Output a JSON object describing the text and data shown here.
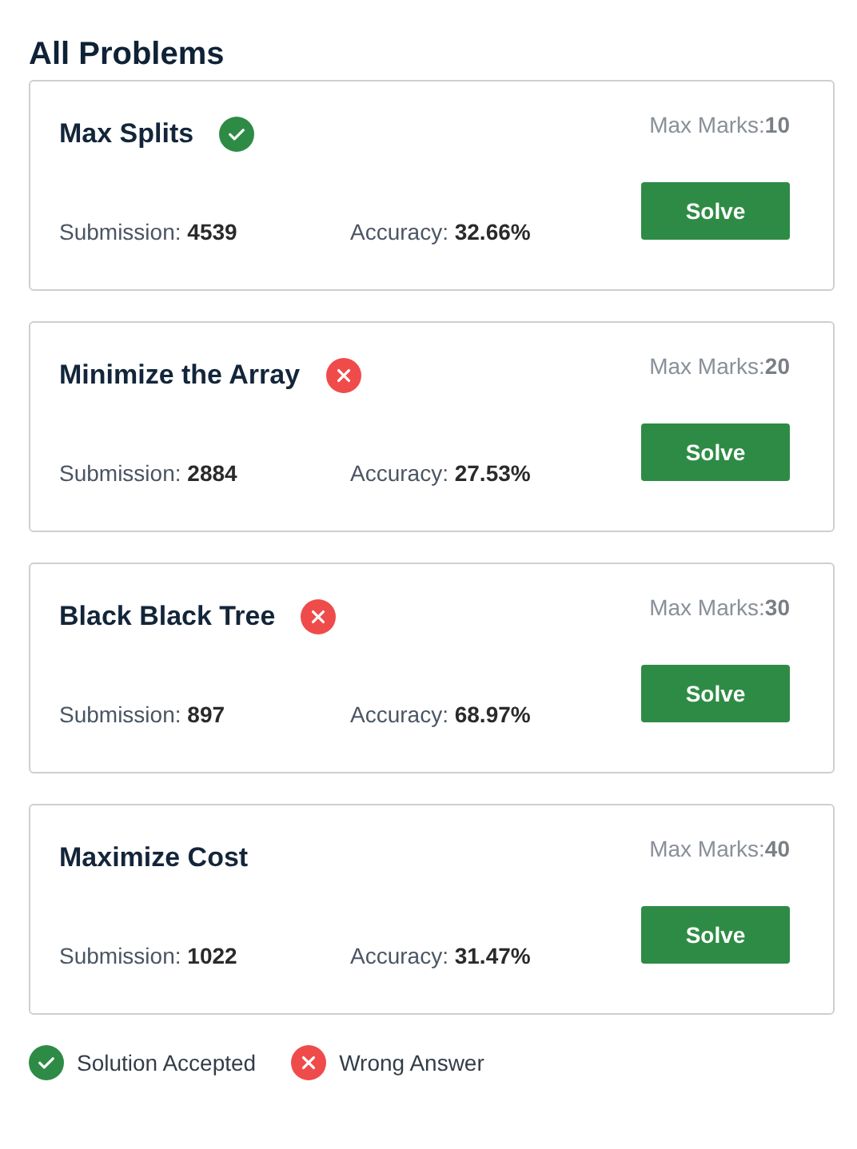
{
  "heading": "All Problems",
  "problems": [
    {
      "title": "Max Splits",
      "kind": "accepted",
      "max_marks_label": "Max Marks:",
      "max_marks": "10",
      "submission_label": "Submission:",
      "submission": "4539",
      "accuracy_label": "Accuracy:",
      "accuracy": "32.66%",
      "button": "Solve"
    },
    {
      "title": "Minimize the Array",
      "kind": "wrong",
      "max_marks_label": "Max Marks:",
      "max_marks": "20",
      "submission_label": "Submission:",
      "submission": "2884",
      "accuracy_label": "Accuracy:",
      "accuracy": "27.53%",
      "button": "Solve"
    },
    {
      "title": "Black Black Tree",
      "kind": "wrong",
      "max_marks_label": "Max Marks:",
      "max_marks": "30",
      "submission_label": "Submission:",
      "submission": "897",
      "accuracy_label": "Accuracy:",
      "accuracy": "68.97%",
      "button": "Solve"
    },
    {
      "title": "Maximize Cost",
      "max_marks_label": "Max Marks:",
      "max_marks": "40",
      "submission_label": "Submission:",
      "submission": "1022",
      "accuracy_label": "Accuracy:",
      "accuracy": "31.47%",
      "button": "Solve"
    }
  ],
  "legend": [
    {
      "kind": "accepted",
      "label": "Solution Accepted"
    },
    {
      "kind": "wrong",
      "label": "Wrong Answer"
    }
  ]
}
